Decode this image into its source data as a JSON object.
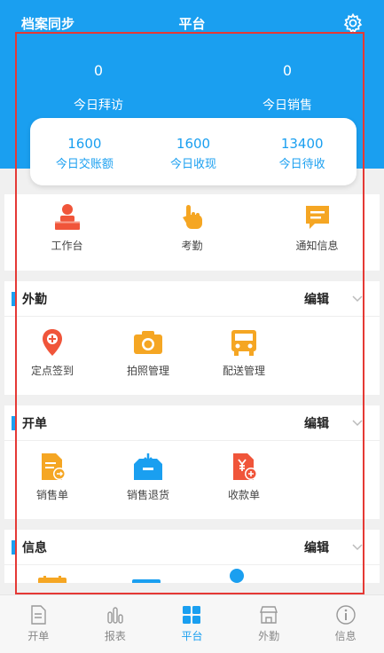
{
  "header": {
    "left_title": "档案同步",
    "center_title": "平台",
    "settings_icon": "gear-icon",
    "accent_color": "#1a9ff0"
  },
  "stats": [
    {
      "value": "0",
      "label": "今日拜访"
    },
    {
      "value": "0",
      "label": "今日销售"
    }
  ],
  "summary": [
    {
      "value": "1600",
      "label": "今日交账额"
    },
    {
      "value": "1600",
      "label": "今日收现"
    },
    {
      "value": "13400",
      "label": "今日待收"
    }
  ],
  "quick": [
    {
      "label": "工作台",
      "icon": "workbench-icon"
    },
    {
      "label": "考勤",
      "icon": "hand-icon"
    },
    {
      "label": "通知信息",
      "icon": "message-icon"
    }
  ],
  "sections": [
    {
      "title": "外勤",
      "edit": "编辑",
      "items": [
        {
          "label": "定点签到",
          "icon": "location-pin-icon"
        },
        {
          "label": "拍照管理",
          "icon": "camera-icon"
        },
        {
          "label": "配送管理",
          "icon": "truck-icon"
        }
      ]
    },
    {
      "title": "开单",
      "edit": "编辑",
      "items": [
        {
          "label": "销售单",
          "icon": "sales-document-icon"
        },
        {
          "label": "销售退货",
          "icon": "return-box-icon"
        },
        {
          "label": "收款单",
          "icon": "receipt-yuan-icon"
        }
      ]
    },
    {
      "title": "信息",
      "edit": "编辑"
    }
  ],
  "tabbar": [
    {
      "label": "开单",
      "icon": "document-icon"
    },
    {
      "label": "报表",
      "icon": "bar-chart-icon"
    },
    {
      "label": "平台",
      "icon": "grid-icon",
      "active": true
    },
    {
      "label": "外勤",
      "icon": "store-icon"
    },
    {
      "label": "信息",
      "icon": "info-icon"
    }
  ]
}
